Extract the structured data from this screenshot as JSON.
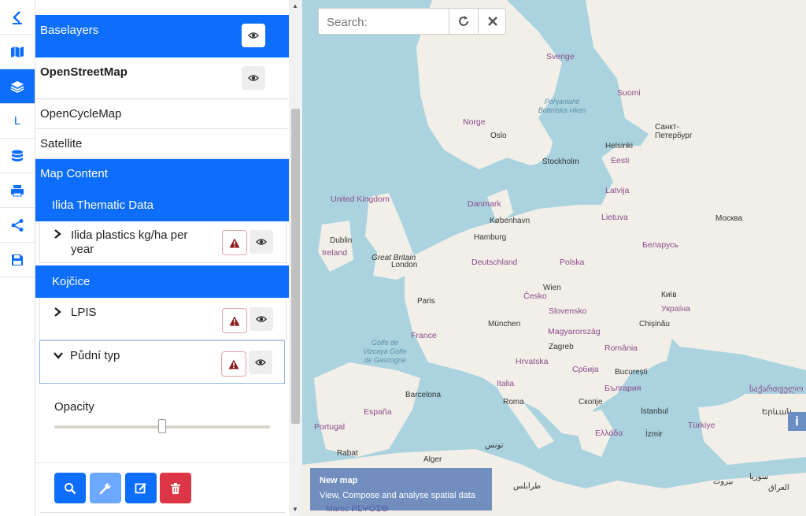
{
  "sidebar_icons": [
    {
      "name": "back-icon"
    },
    {
      "name": "map-icon"
    },
    {
      "name": "layers-icon"
    },
    {
      "name": "legend-icon",
      "letter": "L"
    },
    {
      "name": "datasource-icon"
    },
    {
      "name": "print-icon"
    },
    {
      "name": "share-icon"
    },
    {
      "name": "save-icon"
    }
  ],
  "panel": {
    "baselayers_header": "Baselayers",
    "baselayers": [
      "OpenStreetMap",
      "OpenCycleMap",
      "Satellite"
    ],
    "map_content_header": "Map Content",
    "groups": [
      {
        "title": "Ilida Thematic Data",
        "layers": [
          {
            "label": "Ilida plastics kg/ha per year",
            "expanded": false
          }
        ]
      },
      {
        "title": "Kojčice",
        "layers": [
          {
            "label": "LPIS",
            "expanded": false
          },
          {
            "label": "Půdní typ",
            "expanded": true
          }
        ]
      }
    ],
    "opacity_label": "Opacity",
    "opacity_value": 0.5
  },
  "search": {
    "placeholder": "Search:"
  },
  "info": {
    "title": "New map",
    "subtitle": "View, Compose and analyse spatial data",
    "button": "i"
  },
  "colors": {
    "primary": "#0d6efd",
    "danger": "#dc3545",
    "info": "#6ea8fe",
    "water": "#aad3df",
    "land": "#f2efe9"
  },
  "map_labels": {
    "countries": [
      "Sverige",
      "Suomi",
      "Norge",
      "Eesti",
      "Latvija",
      "Lietuva",
      "Danmark",
      "United Kingdom",
      "Ireland",
      "Deutschland",
      "Polska",
      "Беларусь",
      "Česko",
      "Slovensko",
      "Україна",
      "Magyarország",
      "România",
      "France",
      "Hrvatska",
      "Србија",
      "България",
      "Italia",
      "España",
      "Portugal",
      "Ελλάδα",
      "Türkiye",
      "საქართველო",
      "Maroc ⵍⵎⵖⵔⵉⴱ"
    ],
    "cities": [
      "Oslo",
      "Stockholm",
      "Helsinki",
      "Санкт-Петербург",
      "København",
      "Москва",
      "Hamburg",
      "London",
      "Great Britain",
      "Paris",
      "München",
      "Wien",
      "Київ",
      "Chișinău",
      "Zagreb",
      "București",
      "Barcelona",
      "Roma",
      "Скопје",
      "İstanbul",
      "İzmir",
      "Rabat",
      "Alger",
      "تونس",
      "طرابلس",
      "بيروت",
      "العراق",
      "سوريا",
      "Երևան",
      "Dublin"
    ],
    "seas": [
      "Pohjanlahti Bottniska viken",
      "Golfo de Vizcaya Golfe de Gascogne"
    ]
  }
}
